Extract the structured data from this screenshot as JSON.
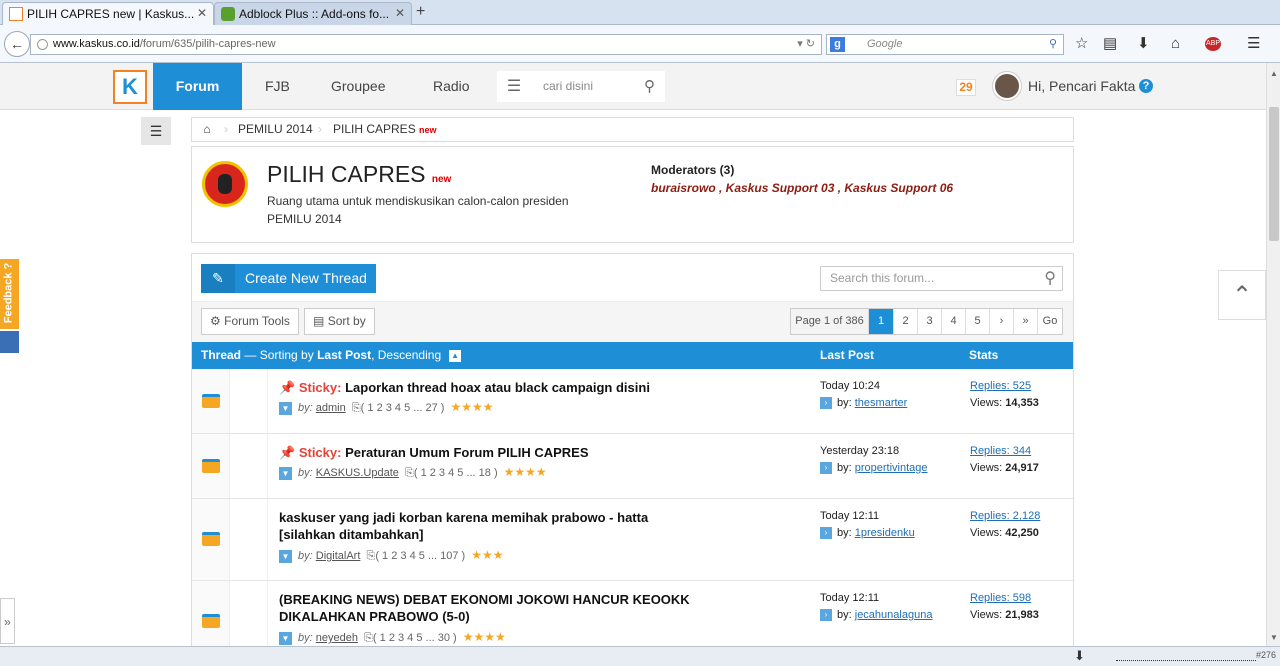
{
  "browser": {
    "tabs": [
      {
        "label": "PILIH CAPRES new | Kaskus..."
      },
      {
        "label": "Adblock Plus :: Add-ons fo..."
      }
    ],
    "new_tab": "+",
    "url_host": "www.kaskus.co.id",
    "url_path": "/forum/635/pilih-capres-new",
    "search_engine": "Google",
    "search_placeholder": "Google",
    "abp_badge": "ABP"
  },
  "header": {
    "logo_letter": "K",
    "nav": [
      "Forum",
      "FJB",
      "Groupee",
      "Radio"
    ],
    "search_placeholder": "cari disini",
    "notif_count": "29",
    "greeting": "Hi, Pencari Fakta",
    "help": "?"
  },
  "breadcrumb": {
    "items": [
      "PEMILU 2014",
      "PILIH CAPRES"
    ],
    "new_tag": "new"
  },
  "forum": {
    "title": "PILIH CAPRES",
    "new_tag": "new",
    "description": "Ruang utama untuk mendiskusikan calon-calon presiden PEMILU 2014",
    "moderators_label": "Moderators (3)",
    "moderators": "buraisrowo , Kaskus Support 03 , Kaskus Support 06"
  },
  "toolbar": {
    "create_thread": "Create New Thread",
    "search_placeholder": "Search this forum...",
    "forum_tools": "Forum Tools",
    "sort_by": "Sort by"
  },
  "pager": {
    "info": "Page 1 of 386",
    "pages": [
      "1",
      "2",
      "3",
      "4",
      "5"
    ],
    "next": "›",
    "last": "»",
    "go": "Go"
  },
  "table_header": {
    "thread": "Thread",
    "sorting_prefix": "— Sorting by ",
    "sort_field": "Last Post",
    "sort_dir": ", Descending",
    "last_post": "Last Post",
    "stats": "Stats"
  },
  "threads": [
    {
      "sticky": "Sticky:",
      "title": "Laporkan thread hoax atau black campaign disini",
      "by_label": "by:",
      "author": "admin",
      "pages": "1 2 3 4 5 ... 27",
      "stars": "★★★★",
      "lp_time": "Today 10:24",
      "lp_by": "by:",
      "lp_user": "thesmarter",
      "replies": "Replies: 525",
      "views_label": "Views:",
      "views": "14,353"
    },
    {
      "sticky": "Sticky:",
      "title": "Peraturan Umum Forum PILIH CAPRES",
      "by_label": "by:",
      "author": "KASKUS.Update",
      "pages": "1 2 3 4 5 ... 18",
      "stars": "★★★★",
      "lp_time": "Yesterday 23:18",
      "lp_by": "by:",
      "lp_user": "propertivintage",
      "replies": "Replies: 344",
      "views_label": "Views:",
      "views": "24,917"
    },
    {
      "sticky": "",
      "title": "kaskuser yang jadi korban karena memihak prabowo - hatta [silahkan ditambahkan]",
      "by_label": "by:",
      "author": "DigitalArt",
      "pages": "1 2 3 4 5 ... 107",
      "stars": "★★★",
      "lp_time": "Today 12:11",
      "lp_by": "by:",
      "lp_user": "1presidenku",
      "replies": "Replies: 2,128",
      "views_label": "Views:",
      "views": "42,250"
    },
    {
      "sticky": "",
      "title": "(BREAKING NEWS) DEBAT EKONOMI JOKOWI HANCUR KEOOKK DIKALAHKAN PRABOWO (5-0)",
      "by_label": "by:",
      "author": "neyedeh",
      "pages": "1 2 3 4 5 ... 30",
      "stars": "★★★★",
      "lp_time": "Today 12:11",
      "lp_by": "by:",
      "lp_user": "jecahunalaguna",
      "replies": "Replies: 598",
      "views_label": "Views:",
      "views": "21,983"
    }
  ],
  "side": {
    "feedback": "Feedback ?"
  },
  "statusbar": {
    "counter": "#276"
  },
  "colors": {
    "brand_blue": "#1e8fd6",
    "brand_orange": "#f58220",
    "sticky_red": "#e2443a",
    "moderator_red": "#8b1d12"
  }
}
